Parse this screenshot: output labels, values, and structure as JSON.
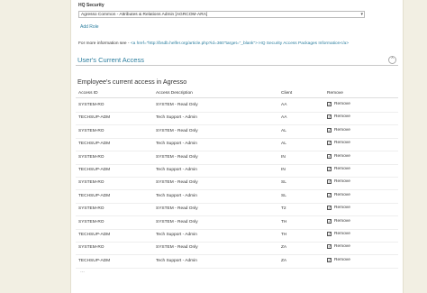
{
  "hq": {
    "label": "HQ Security",
    "selected_role": "Agresso Common - Attributes & Relations Admin [AGRCOM-ARA]",
    "add_role": "Add Role",
    "info_prefix": "For more information see - ",
    "info_link": "<a href=\"http://bsdb.helfer.org/article.php?id=360\"target=\"_blank\"> HQ Security Access Packages Information</a>"
  },
  "section": {
    "title": "User's Current Access",
    "collapse_icon": "chevron-up-icon"
  },
  "table": {
    "title": "Employee's current access in Agresso",
    "headers": [
      "Access ID",
      "Access Description",
      "Client",
      "Remove"
    ],
    "rows": [
      {
        "access_id": "SYSTEM-RO",
        "description": "SYSTEM - Read Only",
        "client": "AA",
        "remove": "Remove"
      },
      {
        "access_id": "TECHSUP-ADM",
        "description": "Tech Support - Admin",
        "client": "AA",
        "remove": "Remove"
      },
      {
        "access_id": "SYSTEM-RO",
        "description": "SYSTEM - Read Only",
        "client": "AL",
        "remove": "Remove"
      },
      {
        "access_id": "TECHSUP-ADM",
        "description": "Tech Support - Admin",
        "client": "AL",
        "remove": "Remove"
      },
      {
        "access_id": "SYSTEM-RO",
        "description": "SYSTEM - Read Only",
        "client": "IN",
        "remove": "Remove"
      },
      {
        "access_id": "TECHSUP-ADM",
        "description": "Tech Support - Admin",
        "client": "IN",
        "remove": "Remove"
      },
      {
        "access_id": "SYSTEM-RO",
        "description": "SYSTEM - Read Only",
        "client": "SL",
        "remove": "Remove"
      },
      {
        "access_id": "TECHSUP-ADM",
        "description": "Tech Support - Admin",
        "client": "SL",
        "remove": "Remove"
      },
      {
        "access_id": "SYSTEM-RO",
        "description": "SYSTEM - Read Only",
        "client": "T2",
        "remove": "Remove"
      },
      {
        "access_id": "SYSTEM-RO",
        "description": "SYSTEM - Read Only",
        "client": "TH",
        "remove": "Remove"
      },
      {
        "access_id": "TECHSUP-ADM",
        "description": "Tech Support - Admin",
        "client": "TH",
        "remove": "Remove"
      },
      {
        "access_id": "SYSTEM-RO",
        "description": "SYSTEM - Read Only",
        "client": "ZA",
        "remove": "Remove"
      },
      {
        "access_id": "TECHSUP-ADM",
        "description": "Tech Support - Admin",
        "client": "ZA",
        "remove": "Remove"
      }
    ],
    "more_icon": "…"
  },
  "colors": {
    "accent": "#2a7d9e",
    "background": "#f2efe3",
    "panel": "#ffffff"
  }
}
